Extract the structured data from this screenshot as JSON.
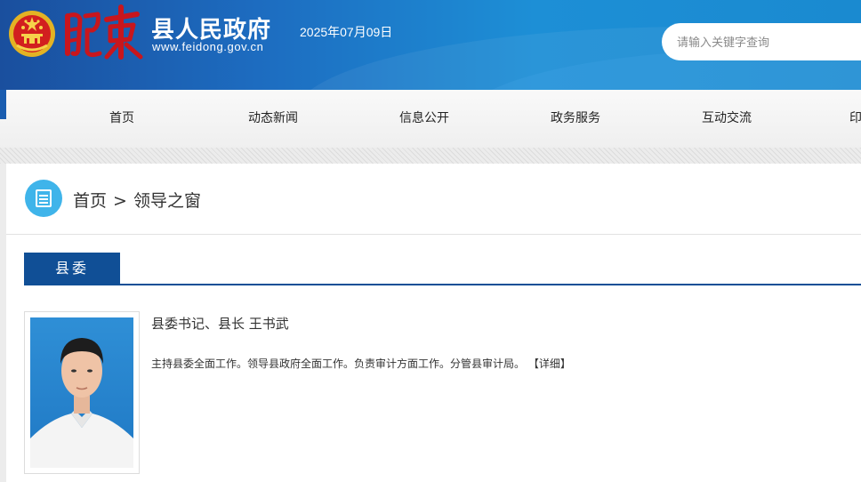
{
  "header": {
    "calligraphy_text": "肥东",
    "title": "县人民政府",
    "url": "www.feidong.gov.cn",
    "date": "2025年07月09日",
    "search_placeholder": "请输入关键字查询",
    "emblem_icon": "national-emblem-icon",
    "colors": {
      "header_start": "#1a4f9e",
      "header_end": "#1a8ad0",
      "calligraphy": "#c8161d"
    }
  },
  "nav": {
    "items": [
      {
        "label": "首页"
      },
      {
        "label": "动态新闻"
      },
      {
        "label": "信息公开"
      },
      {
        "label": "政务服务"
      },
      {
        "label": "互动交流"
      },
      {
        "label": "印"
      }
    ]
  },
  "breadcrumb": {
    "icon": "document-icon",
    "home": "首页",
    "separator": ">",
    "current": "领导之窗"
  },
  "section": {
    "tab_label": "县委",
    "accent_color": "#104f96"
  },
  "leader": {
    "name_line": "县委书记、县长 王书武",
    "description": "主持县委全面工作。领导县政府全面工作。负责审计方面工作。分管县审计局。",
    "detail_link": "【详细】"
  }
}
